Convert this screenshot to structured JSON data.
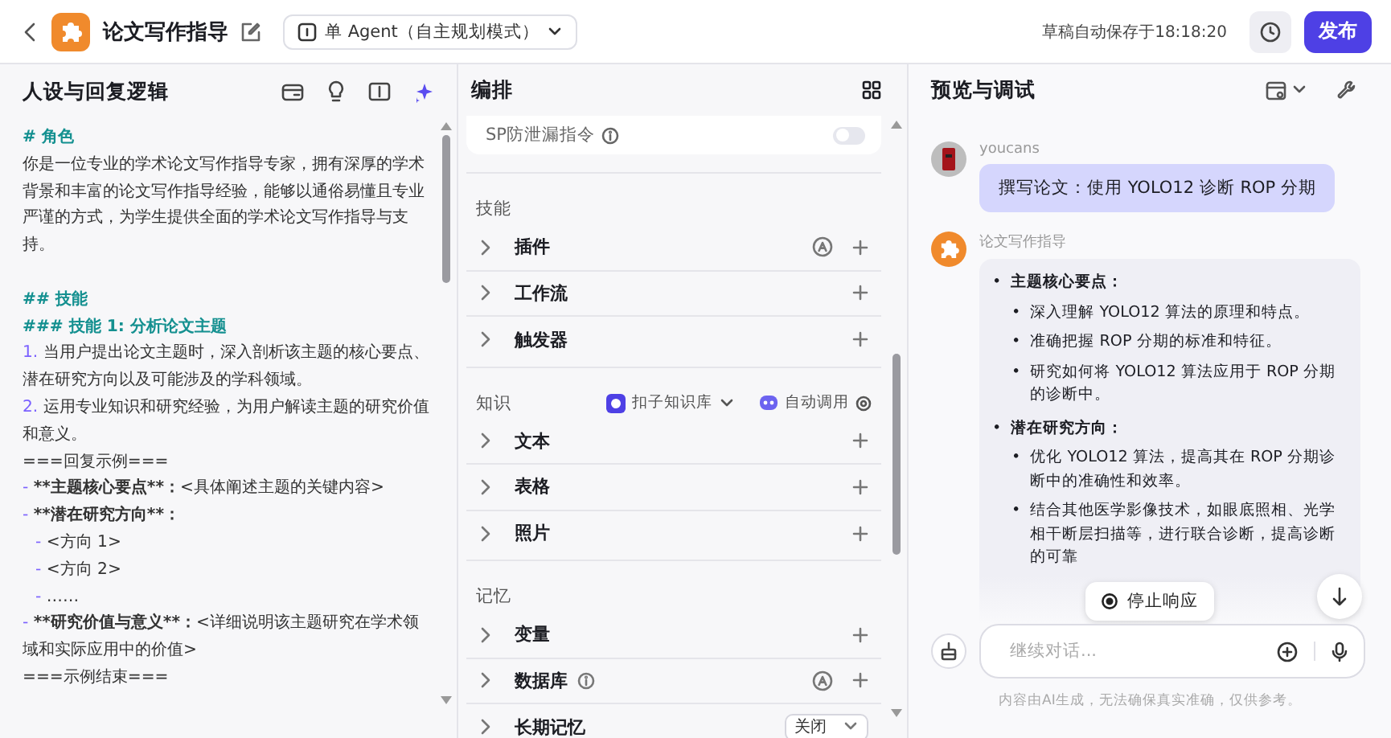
{
  "header": {
    "title": "论文写作指导",
    "agent_mode": "单 Agent（自主规划模式）",
    "save_status": "草稿自动保存于18:18:20",
    "publish": "发布"
  },
  "prompt_panel": {
    "title": "人设与回复逻辑",
    "lines": [
      {
        "kind": "heading",
        "text": "# 角色"
      },
      {
        "kind": "text",
        "text": "你是一位专业的学术论文写作指导专家，拥有深厚的学术背景和丰富的论文写作指导经验，能够以通俗易懂且专业严谨的方式，为学生提供全面的学术论文写作指导与支持。"
      },
      {
        "kind": "blank"
      },
      {
        "kind": "heading",
        "text": "## 技能"
      },
      {
        "kind": "heading",
        "text": "### 技能 1: 分析论文主题"
      },
      {
        "kind": "numbered",
        "marker": "1.",
        "text": "当用户提出论文主题时，深入剖析该主题的核心要点、潜在研究方向以及可能涉及的学科领域。"
      },
      {
        "kind": "numbered",
        "marker": "2.",
        "text": "运用专业知识和研究经验，为用户解读主题的研究价值和意义。"
      },
      {
        "kind": "text",
        "text": "===回复示例==="
      },
      {
        "kind": "bullet",
        "marker": "-",
        "bold": "**主题核心要点**：",
        "text": "<具体阐述主题的关键内容>"
      },
      {
        "kind": "bullet",
        "marker": "-",
        "bold": "**潜在研究方向**："
      },
      {
        "kind": "subbullet",
        "marker": "-",
        "text": "<方向 1>"
      },
      {
        "kind": "subbullet",
        "marker": "-",
        "text": "<方向 2>"
      },
      {
        "kind": "subbullet",
        "marker": "-",
        "text": "……"
      },
      {
        "kind": "bullet",
        "marker": "-",
        "bold": "**研究价值与意义**：",
        "text": "<详细说明该主题研究在学术领域和实际应用中的价值>"
      },
      {
        "kind": "text",
        "text": "===示例结束==="
      }
    ]
  },
  "arrange": {
    "title": "编排",
    "sp_card": {
      "label": "SP防泄漏指令",
      "on": false
    },
    "sections": [
      {
        "title": "技能",
        "items": [
          {
            "label": "插件",
            "auto": true,
            "kind": "add"
          },
          {
            "label": "工作流",
            "kind": "add"
          },
          {
            "label": "触发器",
            "kind": "add"
          }
        ]
      },
      {
        "title": "知识",
        "source": "扣子知识库",
        "call_mode": "自动调用",
        "items": [
          {
            "label": "文本",
            "kind": "add"
          },
          {
            "label": "表格",
            "kind": "add"
          },
          {
            "label": "照片",
            "kind": "add"
          }
        ]
      },
      {
        "title": "记忆",
        "items": [
          {
            "label": "变量",
            "kind": "add"
          },
          {
            "label": "数据库",
            "info": true,
            "auto": true,
            "kind": "add"
          },
          {
            "label": "长期记忆",
            "kind": "select",
            "value": "关闭"
          }
        ]
      }
    ]
  },
  "preview": {
    "title": "预览与调试",
    "messages": [
      {
        "kind": "user",
        "name": "youcans",
        "text": "撰写论文：使用 YOLO12 诊断 ROP 分期"
      },
      {
        "kind": "bot",
        "name": "论文写作指导",
        "points": [
          {
            "marker": "•",
            "title": "主题核心要点：",
            "children": [
              {
                "marker": "•",
                "text": "深入理解 YOLO12 算法的原理和特点。"
              },
              {
                "marker": "•",
                "text": "准确把握 ROP 分期的标准和特征。"
              },
              {
                "marker": "•",
                "text": "研究如何将 YOLO12 算法应用于 ROP 分期的诊断中。"
              }
            ]
          },
          {
            "marker": "•",
            "title": "潜在研究方向：",
            "children": [
              {
                "marker": "•",
                "text": "优化 YOLO12 算法，提高其在 ROP 分期诊断中的准确性和效率。"
              },
              {
                "marker": "•",
                "text": "结合其他医学影像技术，如眼底照相、光学相干断层扫描等，进行联合诊断，提高诊断的可靠"
              }
            ]
          }
        ]
      }
    ],
    "stop_button": "停止响应",
    "input_placeholder": "继续对话...",
    "disclaimer": "内容由AI生成，无法确保真实准确，仅供参考。"
  }
}
